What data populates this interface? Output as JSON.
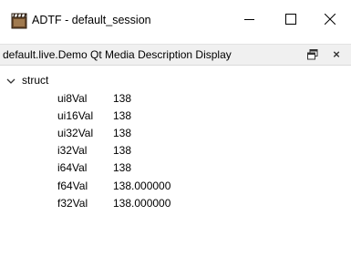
{
  "window": {
    "title": "ADTF - default_session",
    "icons": {
      "app": "adtf-app-icon",
      "minimize": "minimize-icon",
      "maximize": "maximize-icon",
      "close": "close-icon"
    }
  },
  "dock": {
    "title": "default.live.Demo Qt Media Description Display",
    "float_icon": "float-dock-icon",
    "close_label": "×"
  },
  "tree": {
    "root_label": "struct",
    "fields": [
      {
        "name": "ui8Val",
        "value": "138"
      },
      {
        "name": "ui16Val",
        "value": "138"
      },
      {
        "name": "ui32Val",
        "value": "138"
      },
      {
        "name": "i32Val",
        "value": "138"
      },
      {
        "name": "i64Val",
        "value": "138"
      },
      {
        "name": "f64Val",
        "value": "138.000000"
      },
      {
        "name": "f32Val",
        "value": "138.000000"
      }
    ]
  }
}
